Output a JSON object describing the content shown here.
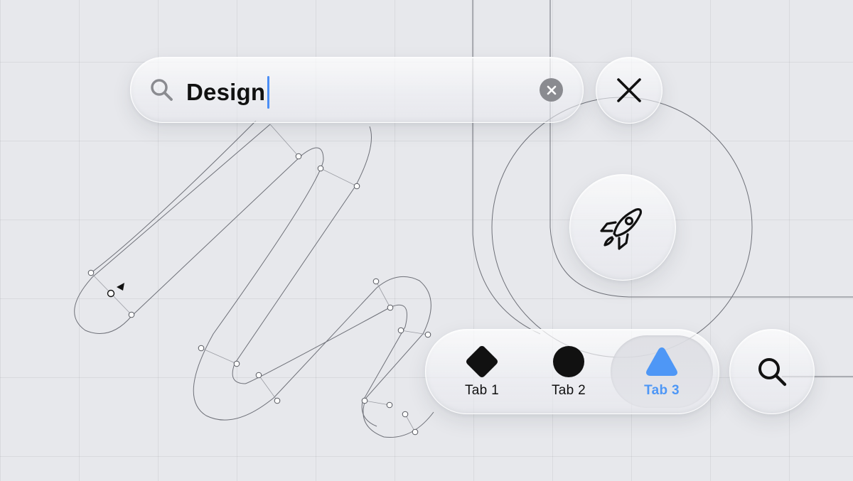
{
  "search": {
    "query": "Design",
    "icon": "magnifier-icon",
    "clear_icon": "clear-x-circle-icon"
  },
  "actions": {
    "close_icon": "close-x-icon",
    "rocket_icon": "rocket-icon",
    "search_icon": "magnifier-icon"
  },
  "tabs": [
    {
      "label": "Tab 1",
      "icon": "diamond-icon",
      "selected": false
    },
    {
      "label": "Tab 2",
      "icon": "circle-icon",
      "selected": false
    },
    {
      "label": "Tab 3",
      "icon": "triangle-icon",
      "selected": true
    }
  ],
  "colors": {
    "accent": "#4e97f6",
    "caret": "#4b8ef5",
    "background": "#e7e8ec",
    "icon": "#111111",
    "clear_button": "#8a8b90"
  }
}
